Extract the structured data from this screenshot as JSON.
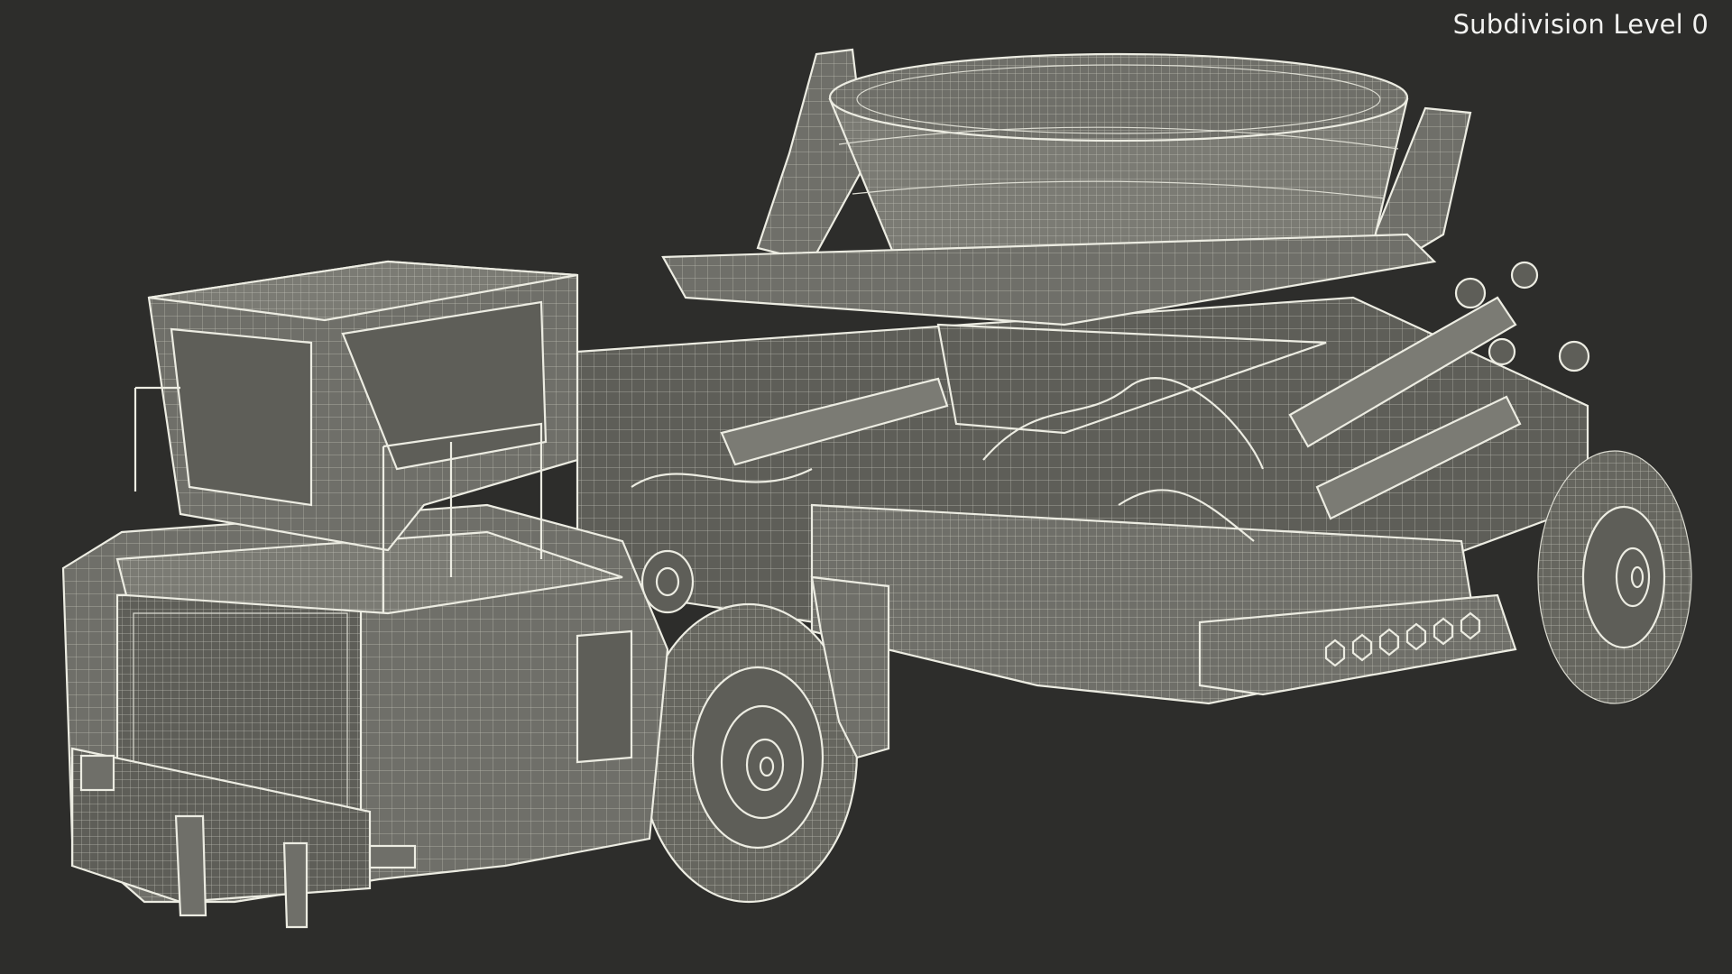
{
  "overlay": {
    "subdivision_label": "Subdivision Level 0"
  },
  "colors": {
    "background": "#2d2d2b",
    "model_fill": "#6f6f69",
    "wireframe": "#dcdcd2",
    "label_text": "#f2f2f0"
  }
}
